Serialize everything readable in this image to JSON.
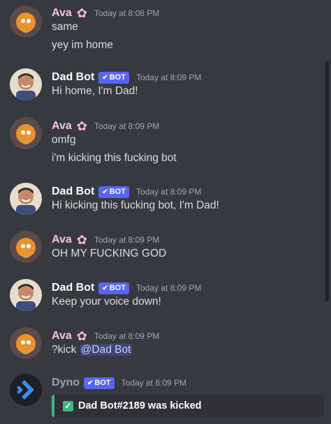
{
  "messages": [
    {
      "author": "Ava",
      "time": "Today at 8:08 PM",
      "lines": [
        "same",
        "yey im home"
      ]
    },
    {
      "author": "Dad Bot",
      "badge": "BOT",
      "time": "Today at 8:09 PM",
      "lines": [
        "Hi home, I'm Dad!"
      ]
    },
    {
      "author": "Ava",
      "time": "Today at 8:09 PM",
      "lines": [
        "omfg",
        "i'm kicking this fucking bot"
      ]
    },
    {
      "author": "Dad Bot",
      "badge": "BOT",
      "time": "Today at 8:09 PM",
      "lines": [
        "Hi kicking this fucking bot, I'm Dad!"
      ]
    },
    {
      "author": "Ava",
      "time": "Today at 8:09 PM",
      "lines": [
        "OH MY FUCKING GOD"
      ]
    },
    {
      "author": "Dad Bot",
      "badge": "BOT",
      "time": "Today at 8:09 PM",
      "lines": [
        "Keep your voice down!"
      ]
    },
    {
      "author": "Ava",
      "time": "Today at 8:09 PM",
      "command": "?kick",
      "mention": "@Dad Bot"
    },
    {
      "author": "Dyno",
      "badge": "BOT",
      "time": "Today at 8:09 PM",
      "embed": "Dad Bot#2189 was kicked"
    }
  ],
  "colors": {
    "background": "#36393f",
    "bot_badge": "#5865f2",
    "success": "#43b581",
    "mention_bg": "#414675"
  },
  "icons": {
    "ava_decoration": "flower-icon",
    "bot_badge": "check-icon",
    "embed": "checkmark-icon"
  }
}
